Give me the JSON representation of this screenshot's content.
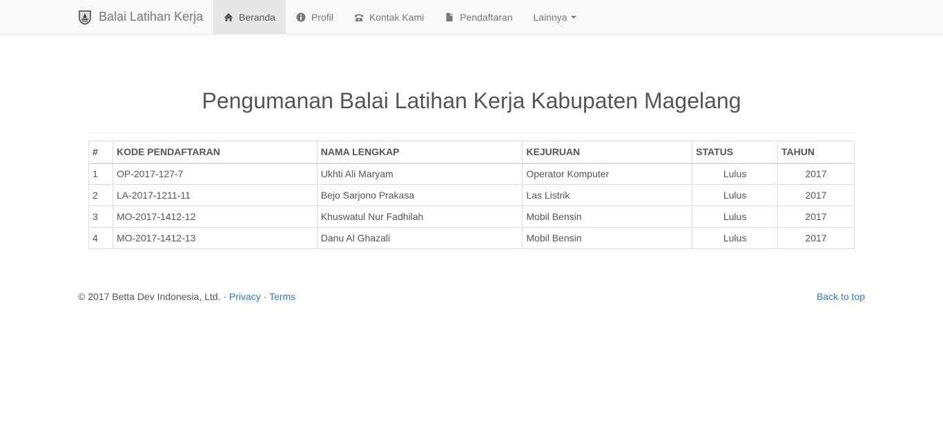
{
  "navbar": {
    "brand": "Balai Latihan Kerja",
    "items": [
      {
        "label": "Beranda",
        "icon": "home-icon",
        "active": true
      },
      {
        "label": "Profil",
        "icon": "info-sign-icon",
        "active": false
      },
      {
        "label": "Kontak Kami",
        "icon": "phone-alt-icon",
        "active": false
      },
      {
        "label": "Pendaftaran",
        "icon": "file-icon",
        "active": false
      },
      {
        "label": "Lainnya",
        "icon": "caret-down-icon",
        "active": false
      }
    ]
  },
  "page": {
    "title": "Pengumanan Balai Latihan Kerja Kabupaten Magelang"
  },
  "table": {
    "headers": [
      "#",
      "KODE PENDAFTARAN",
      "NAMA LENGKAP",
      "KEJURUAN",
      "STATUS",
      "TAHUN"
    ],
    "rows": [
      [
        "1",
        "OP-2017-127-7",
        "Ukhti Ali Maryam",
        "Operator Komputer",
        "Lulus",
        "2017"
      ],
      [
        "2",
        "LA-2017-1211-11",
        "Bejo Sarjono Prakasa",
        "Las Listrik",
        "Lulus",
        "2017"
      ],
      [
        "3",
        "MO-2017-1412-12",
        "Khuswatul Nur Fadhilah",
        "Mobil Bensin",
        "Lulus",
        "2017"
      ],
      [
        "4",
        "MO-2017-1412-13",
        "Danu Al Ghazali",
        "Mobil Bensin",
        "Lulus",
        "2017"
      ]
    ]
  },
  "footer": {
    "copyright": "© 2017 Betta Dev Indonesia, Ltd. · ",
    "privacy": "Privacy",
    "separator": " · ",
    "terms": "Terms",
    "back_to_top": "Back to top"
  },
  "colors": {
    "link": "#337ab7",
    "navbar_bg": "#f8f8f8",
    "active_bg": "#e7e7e7"
  }
}
